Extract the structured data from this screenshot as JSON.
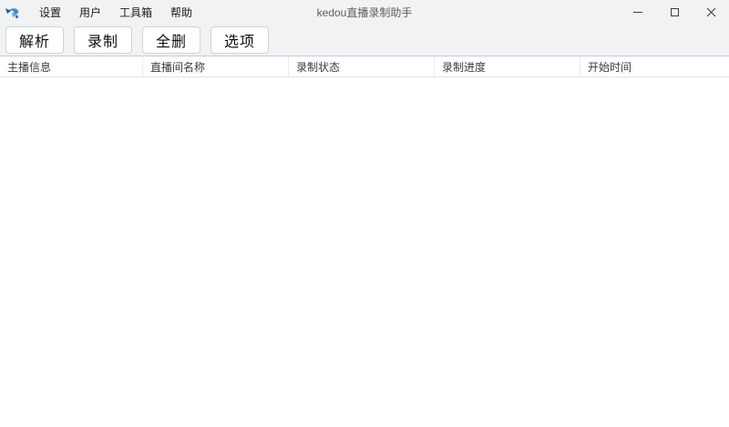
{
  "window": {
    "title": "kedou直播录制助手",
    "app_icon": "kedou-tadpole-logo",
    "controls": [
      {
        "name": "minimize"
      },
      {
        "name": "maximize"
      },
      {
        "name": "close"
      }
    ]
  },
  "menu": {
    "items": [
      {
        "label": "设置"
      },
      {
        "label": "用户"
      },
      {
        "label": "工具箱"
      },
      {
        "label": "帮助"
      }
    ]
  },
  "toolbar": {
    "buttons": [
      {
        "label": "解析"
      },
      {
        "label": "录制"
      },
      {
        "label": "全删"
      },
      {
        "label": "选项"
      }
    ]
  },
  "table": {
    "columns": [
      {
        "label": "主播信息"
      },
      {
        "label": "直播间名称"
      },
      {
        "label": "录制状态"
      },
      {
        "label": "录制进度"
      },
      {
        "label": "开始时间"
      }
    ],
    "rows": []
  },
  "colors": {
    "chrome_bg": "#f1f2f3",
    "toolbar_rule": "#c3ccd4",
    "header_separator": "#ededed",
    "logo_blue_dark": "#1f5a9e",
    "logo_blue_light": "#6aa9dd",
    "title_text": "#606060"
  }
}
